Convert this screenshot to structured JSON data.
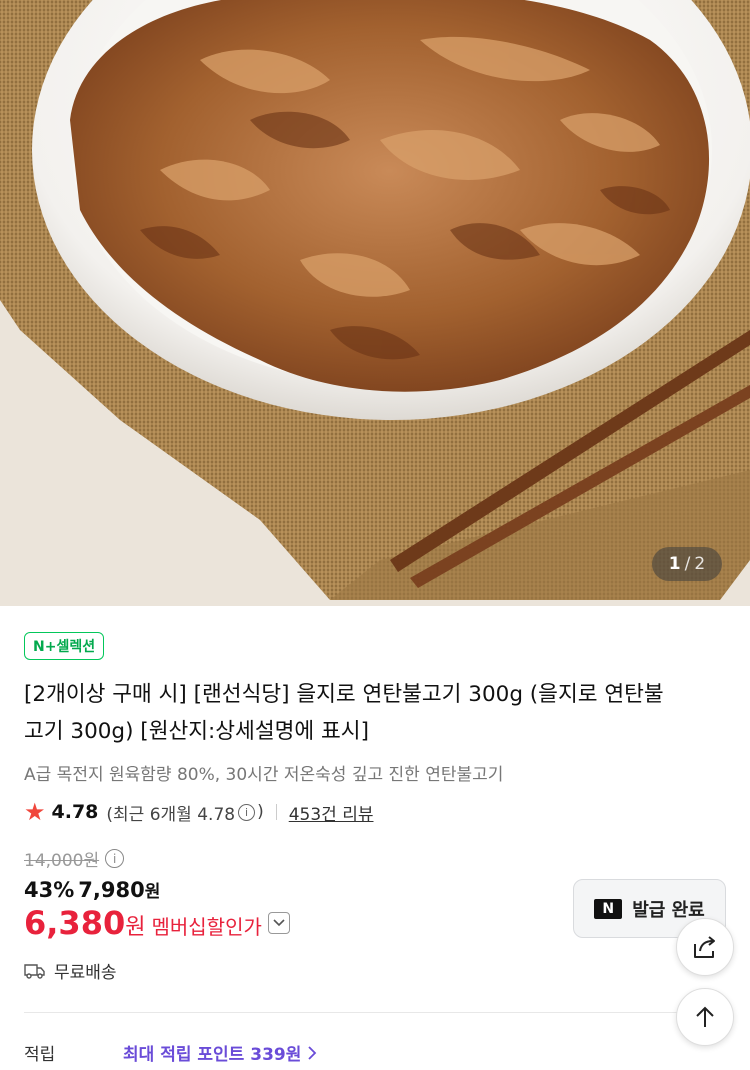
{
  "hero": {
    "image_desc_icon": "bulgogi-photo",
    "page_current": "1",
    "page_separator": "/",
    "page_total": "2"
  },
  "product": {
    "badge": "N+셀렉션",
    "title": "[2개이상 구매 시] [랜선식당] 을지로 연탄불고기 300g (을지로 연탄불고기 300g) [원산지:상세설명에 표시]",
    "subtitle": "A급 목전지 원육함량 80%, 30시간 저온숙성 깊고 진한 연탄불고기"
  },
  "rating": {
    "value": "4.78",
    "recent_prefix": "(최근 6개월 4.78",
    "recent_suffix": ")",
    "reviews": "453건 리뷰"
  },
  "price": {
    "original": "14,000원",
    "discount_pct": "43%",
    "discount_price": "7,980",
    "discount_unit": "원",
    "member_price": "6,380",
    "member_unit": "원",
    "member_label": "멤버십할인가"
  },
  "coupon": {
    "logo": "N",
    "label": "발급 완료"
  },
  "shipping": {
    "label": "무료배송"
  },
  "points": {
    "label": "적립",
    "value": "최대 적립 포인트 339원"
  },
  "colors": {
    "accent_green": "#03c75a",
    "price_red": "#e8223c",
    "points_purple": "#6a4cd8",
    "star": "#f0473c"
  },
  "icons": [
    "star-icon",
    "info-icon",
    "chevron-down-icon",
    "truck-icon",
    "share-icon",
    "arrow-up-icon",
    "chevron-right-icon",
    "naver-n-icon"
  ]
}
